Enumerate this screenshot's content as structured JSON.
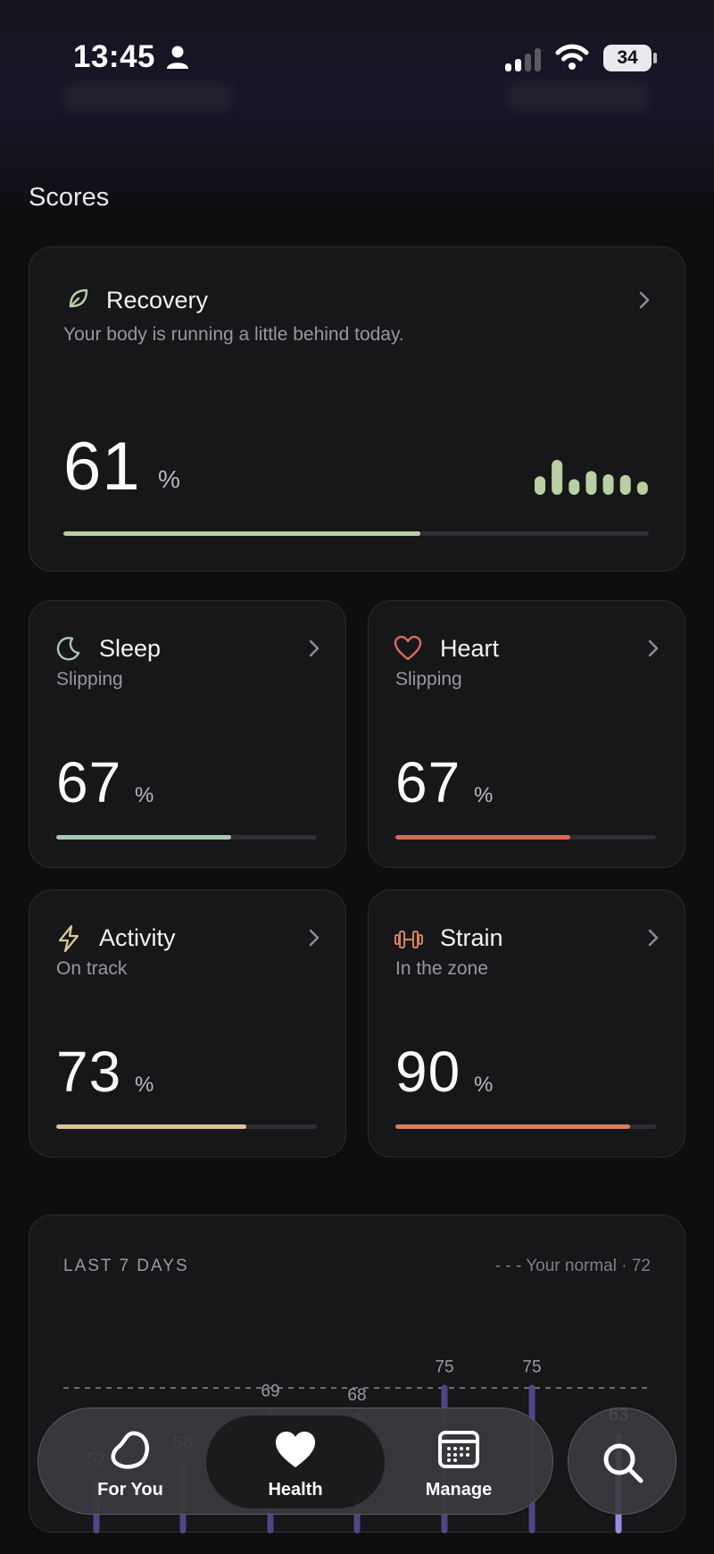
{
  "status_bar": {
    "time": "13:45",
    "battery": "34"
  },
  "section": {
    "title": "Scores"
  },
  "recovery": {
    "name": "Recovery",
    "subtitle": "Your body is running a little behind today.",
    "value": "61",
    "unit": "%",
    "progress": 0.61,
    "color": "#b9cfa4",
    "trend": [
      0.45,
      0.85,
      0.38,
      0.58,
      0.5,
      0.48,
      0.32
    ]
  },
  "sleep": {
    "name": "Sleep",
    "subtitle": "Slipping",
    "value": "67",
    "unit": "%",
    "progress": 0.67,
    "color": "#a9c9b0"
  },
  "heart": {
    "name": "Heart",
    "subtitle": "Slipping",
    "value": "67",
    "unit": "%",
    "progress": 0.67,
    "color": "#d9695a"
  },
  "activity": {
    "name": "Activity",
    "subtitle": "On track",
    "value": "73",
    "unit": "%",
    "progress": 0.73,
    "color": "#d9c796"
  },
  "strain": {
    "name": "Strain",
    "subtitle": "In the zone",
    "value": "90",
    "unit": "%",
    "progress": 0.9,
    "color": "#d87f5c"
  },
  "last7": {
    "title": "LAST 7 DAYS",
    "normal_label": "- - -  Your normal · 72",
    "normal": 72
  },
  "chart_data": {
    "type": "bar",
    "title": "LAST 7 DAYS",
    "values": [
      52,
      56,
      69,
      68,
      75,
      75,
      63
    ],
    "reference_line": {
      "label": "Your normal · 72",
      "value": 72
    },
    "highlight_index": 6
  },
  "nav": {
    "items": [
      {
        "label": "For You",
        "icon": "blob-icon"
      },
      {
        "label": "Health",
        "icon": "heart-icon"
      },
      {
        "label": "Manage",
        "icon": "calendar-icon"
      }
    ],
    "active": "Health"
  }
}
